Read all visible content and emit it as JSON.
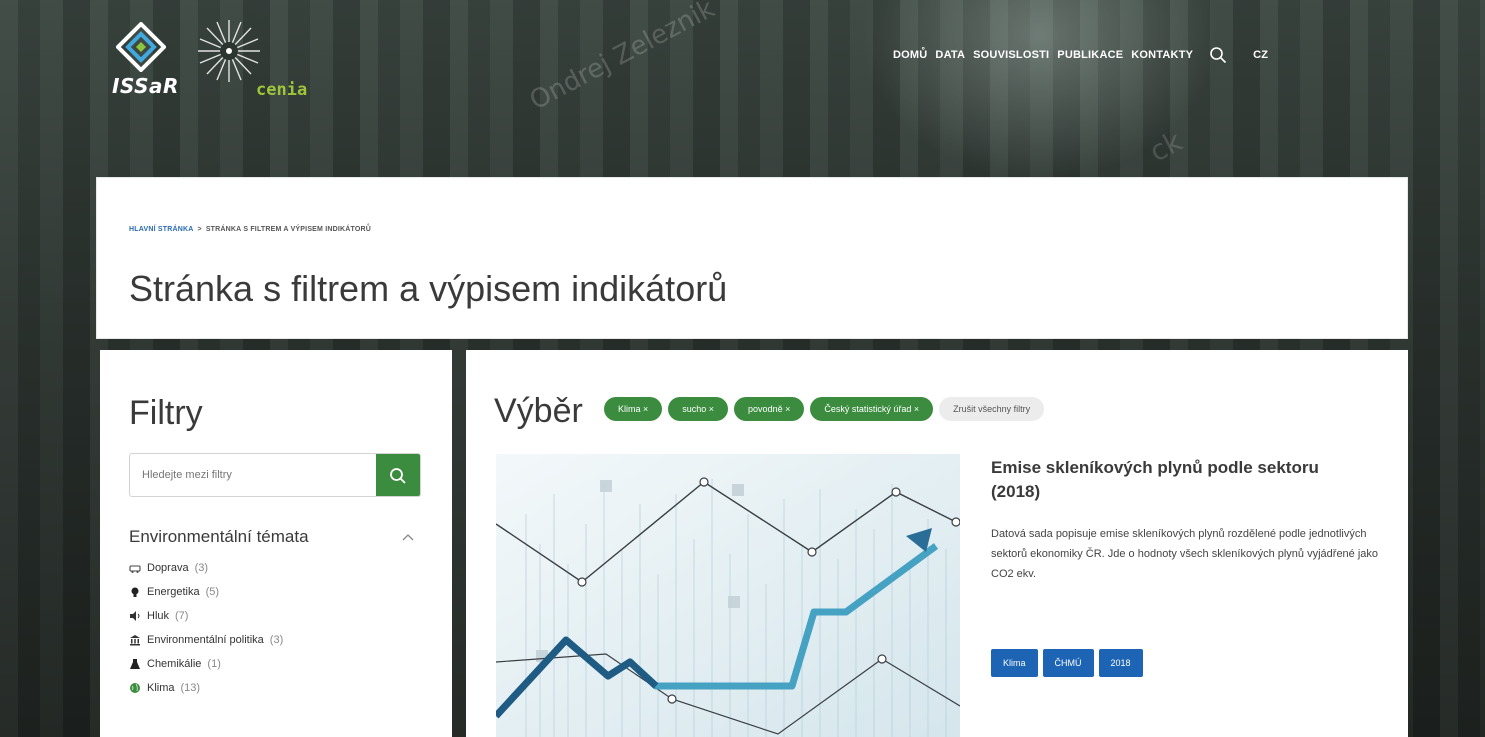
{
  "header": {
    "logo_issar_text": "ISSaR",
    "logo_cenia_text": "cenia",
    "nav": [
      "DOMŮ",
      "DATA",
      "SOUVISLOSTI",
      "PUBLIKACE",
      "KONTAKTY"
    ],
    "language": "CZ"
  },
  "watermark": {
    "text1": "Ondrej Zeleznik",
    "text2": "ck"
  },
  "breadcrumb": {
    "home": "HLAVNÍ STRÁNKA",
    "separator": ">",
    "current": "STRÁNKA S FILTREM A VÝPISEM INDIKÁTORŮ"
  },
  "page_title": "Stránka s filtrem a výpisem indikátorů",
  "sidebar": {
    "title": "Filtry",
    "search_placeholder": "Hledejte mezi filtry",
    "group_title": "Environmentální témata",
    "items": [
      {
        "label": "Doprava",
        "count": "(3)",
        "icon": "car-icon"
      },
      {
        "label": "Energetika",
        "count": "(5)",
        "icon": "bulb-icon"
      },
      {
        "label": "Hluk",
        "count": "(7)",
        "icon": "speaker-icon"
      },
      {
        "label": "Environmentální politika",
        "count": "(3)",
        "icon": "institution-icon"
      },
      {
        "label": "Chemikálie",
        "count": "(1)",
        "icon": "flask-icon"
      },
      {
        "label": "Klima",
        "count": "(13)",
        "icon": "globe-icon"
      }
    ]
  },
  "main": {
    "selection_title": "Výběr",
    "chips": [
      "Klima ×",
      "sucho ×",
      "povodně ×",
      "Český statistický úřad ×"
    ],
    "clear_all": "Zrušit všechny filtry",
    "card": {
      "title": "Emise skleníkových plynů podle sektoru (2018)",
      "description": "Datová sada popisuje emise skleníkových plynů rozdělené podle jednotlivých sektorů ekonomiky ČR. Jde o hodnoty všech skleníkových plynů vyjádřené jako CO2 ekv.",
      "tags": [
        "Klima",
        "ČHMÚ",
        "2018"
      ]
    }
  },
  "colors": {
    "green": "#3b8c3f",
    "blue": "#1e64b4",
    "lime": "#9dc43a"
  }
}
